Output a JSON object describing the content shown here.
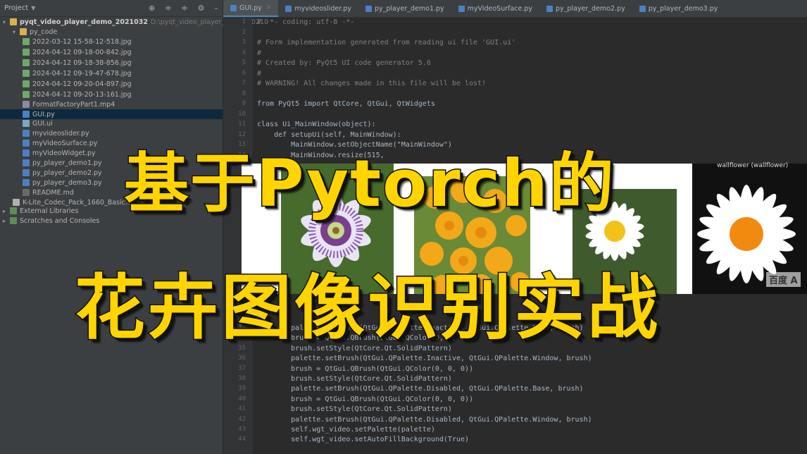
{
  "sidebar": {
    "title": "Project",
    "header_icons": [
      "target-icon",
      "collapse-icon",
      "expand-icon",
      "gear-icon",
      "minimize-icon"
    ],
    "root": "pyqt_video_player_demo_2021032",
    "root_path": "D:\\pyqt_video_player_demo_20210",
    "items": [
      {
        "label": "py_code",
        "type": "folder",
        "indent": 1
      },
      {
        "label": "2022-03-12 15-58-12-518.jpg",
        "type": "img",
        "indent": 2
      },
      {
        "label": "2024-04-12 09-18-00-842.jpg",
        "type": "img",
        "indent": 2
      },
      {
        "label": "2024-04-12 09-18-38-856.jpg",
        "type": "img",
        "indent": 2
      },
      {
        "label": "2024-04-12 09-19-47-678.jpg",
        "type": "img",
        "indent": 2
      },
      {
        "label": "2024-04-12 09-20-04-897.jpg",
        "type": "img",
        "indent": 2
      },
      {
        "label": "2024-04-12 09-20-13-161.jpg",
        "type": "img",
        "indent": 2
      },
      {
        "label": "FormatFactoryPart1.mp4",
        "type": "mp4",
        "indent": 2
      },
      {
        "label": "GUI.py",
        "type": "py",
        "indent": 2,
        "selected": true
      },
      {
        "label": "GUI.ui",
        "type": "ui",
        "indent": 2
      },
      {
        "label": "myvideoslider.py",
        "type": "py",
        "indent": 2
      },
      {
        "label": "myVideoSurface.py",
        "type": "py",
        "indent": 2
      },
      {
        "label": "myVideoWidget.py",
        "type": "py",
        "indent": 2
      },
      {
        "label": "py_player_demo1.py",
        "type": "py",
        "indent": 2
      },
      {
        "label": "py_player_demo2.py",
        "type": "py",
        "indent": 2
      },
      {
        "label": "py_player_demo3.py",
        "type": "py",
        "indent": 2
      },
      {
        "label": "README.md",
        "type": "md",
        "indent": 2
      },
      {
        "label": "K-Lite_Codec_Pack_1660_Basic.exe",
        "type": "exe",
        "indent": 1
      },
      {
        "label": "External Libraries",
        "type": "lib",
        "indent": 0
      },
      {
        "label": "Scratches and Consoles",
        "type": "lib",
        "indent": 0
      }
    ]
  },
  "tabs": [
    {
      "label": "GUI.py",
      "active": true
    },
    {
      "label": "myvideoslider.py"
    },
    {
      "label": "py_player_demo1.py"
    },
    {
      "label": "myVideoSurface.py"
    },
    {
      "label": "py_player_demo2.py"
    },
    {
      "label": "py_player_demo3.py"
    }
  ],
  "editor": {
    "lines_top": [
      {
        "n": "1",
        "text": "# -*- coding: utf-8 -*-",
        "cls": "cm"
      },
      {
        "n": "2",
        "text": ""
      },
      {
        "n": "3",
        "text": "# Form implementation generated from reading ui file 'GUI.ui'",
        "cls": "cm"
      },
      {
        "n": "4",
        "text": "#",
        "cls": "cm"
      },
      {
        "n": "5",
        "text": "# Created by: PyQt5 UI code generator 5.6",
        "cls": "cm"
      },
      {
        "n": "6",
        "text": "#",
        "cls": "cm"
      },
      {
        "n": "7",
        "text": "# WARNING! All changes made in this file will be lost!",
        "cls": "cm"
      },
      {
        "n": "8",
        "text": ""
      },
      {
        "n": "9",
        "text": "from PyQt5 import QtCore, QtGui, QtWidgets"
      },
      {
        "n": "10",
        "text": ""
      },
      {
        "n": "11",
        "text": "class Ui_MainWindow(object):"
      },
      {
        "n": "12",
        "text": "    def setupUi(self, MainWindow):"
      },
      {
        "n": "13",
        "text": "        MainWindow.setObjectName(\"MainWindow\")"
      },
      {
        "n": "14",
        "text": "        MainWindow.resize(515,"
      },
      {
        "n": "15",
        "text": ""
      }
    ],
    "lines_bottom": [
      {
        "n": "33",
        "text": "        palette.setBrush(QtGui.QPalette.Inactive, QtGui.QPalette.Base, brush)"
      },
      {
        "n": "34",
        "text": "        brush = QtGui.QBrush(QtGui.QColor(0, 0, 0))"
      },
      {
        "n": "35",
        "text": "        brush.setStyle(QtCore.Qt.SolidPattern)"
      },
      {
        "n": "36",
        "text": "        palette.setBrush(QtGui.QPalette.Inactive, QtGui.QPalette.Window, brush)"
      },
      {
        "n": "37",
        "text": "        brush = QtGui.QBrush(QtGui.QColor(0, 0, 0))"
      },
      {
        "n": "38",
        "text": "        brush.setStyle(QtCore.Qt.SolidPattern)"
      },
      {
        "n": "39",
        "text": "        palette.setBrush(QtGui.QPalette.Disabled, QtGui.QPalette.Base, brush)"
      },
      {
        "n": "40",
        "text": "        brush = QtGui.QBrush(QtGui.QColor(0, 0, 0))"
      },
      {
        "n": "41",
        "text": "        brush.setStyle(QtCore.Qt.SolidPattern)"
      },
      {
        "n": "42",
        "text": "        palette.setBrush(QtGui.QPalette.Disabled, QtGui.QPalette.Window, brush)"
      },
      {
        "n": "43",
        "text": "        self.wgt_video.setPalette(palette)"
      },
      {
        "n": "44",
        "text": "        self.wgt_video.setAutoFillBackground(True)"
      }
    ]
  },
  "overlay": {
    "title_line1": "基于Pytorch的",
    "title_line2": "花卉图像识别实战",
    "flower_label": "wallflower (wallflower)",
    "watermark": "百度 A"
  },
  "colors": {
    "title_fill": "#ffd400",
    "title_outline": "#111111",
    "editor_bg": "#2b2b2b",
    "sidebar_bg": "#3c3f41",
    "selection": "#0d293e"
  }
}
